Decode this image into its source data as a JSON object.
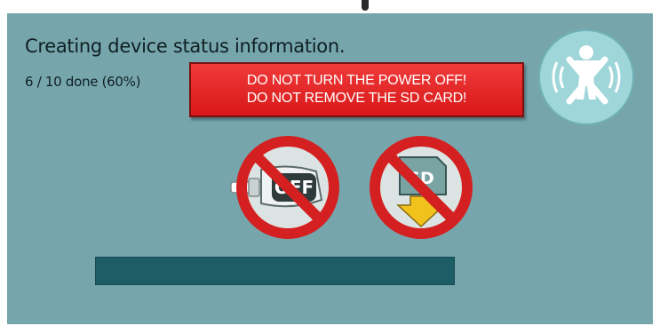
{
  "dialog": {
    "status_title": "Creating device status information.",
    "progress_text": "6 / 10 done (60%)",
    "progress_fraction": 1.0,
    "background_color": "#76a6ac"
  },
  "warning": {
    "line1": "DO NOT TURN THE POWER OFF!",
    "line2": "DO NOT REMOVE THE SD CARD!",
    "color": "#e62222"
  },
  "icons": {
    "off_label": "OFF",
    "sd_label": "SD",
    "badge": "wireless-device-disconnected-icon",
    "power": "no-power-off-icon",
    "sd": "no-sd-removal-icon"
  }
}
